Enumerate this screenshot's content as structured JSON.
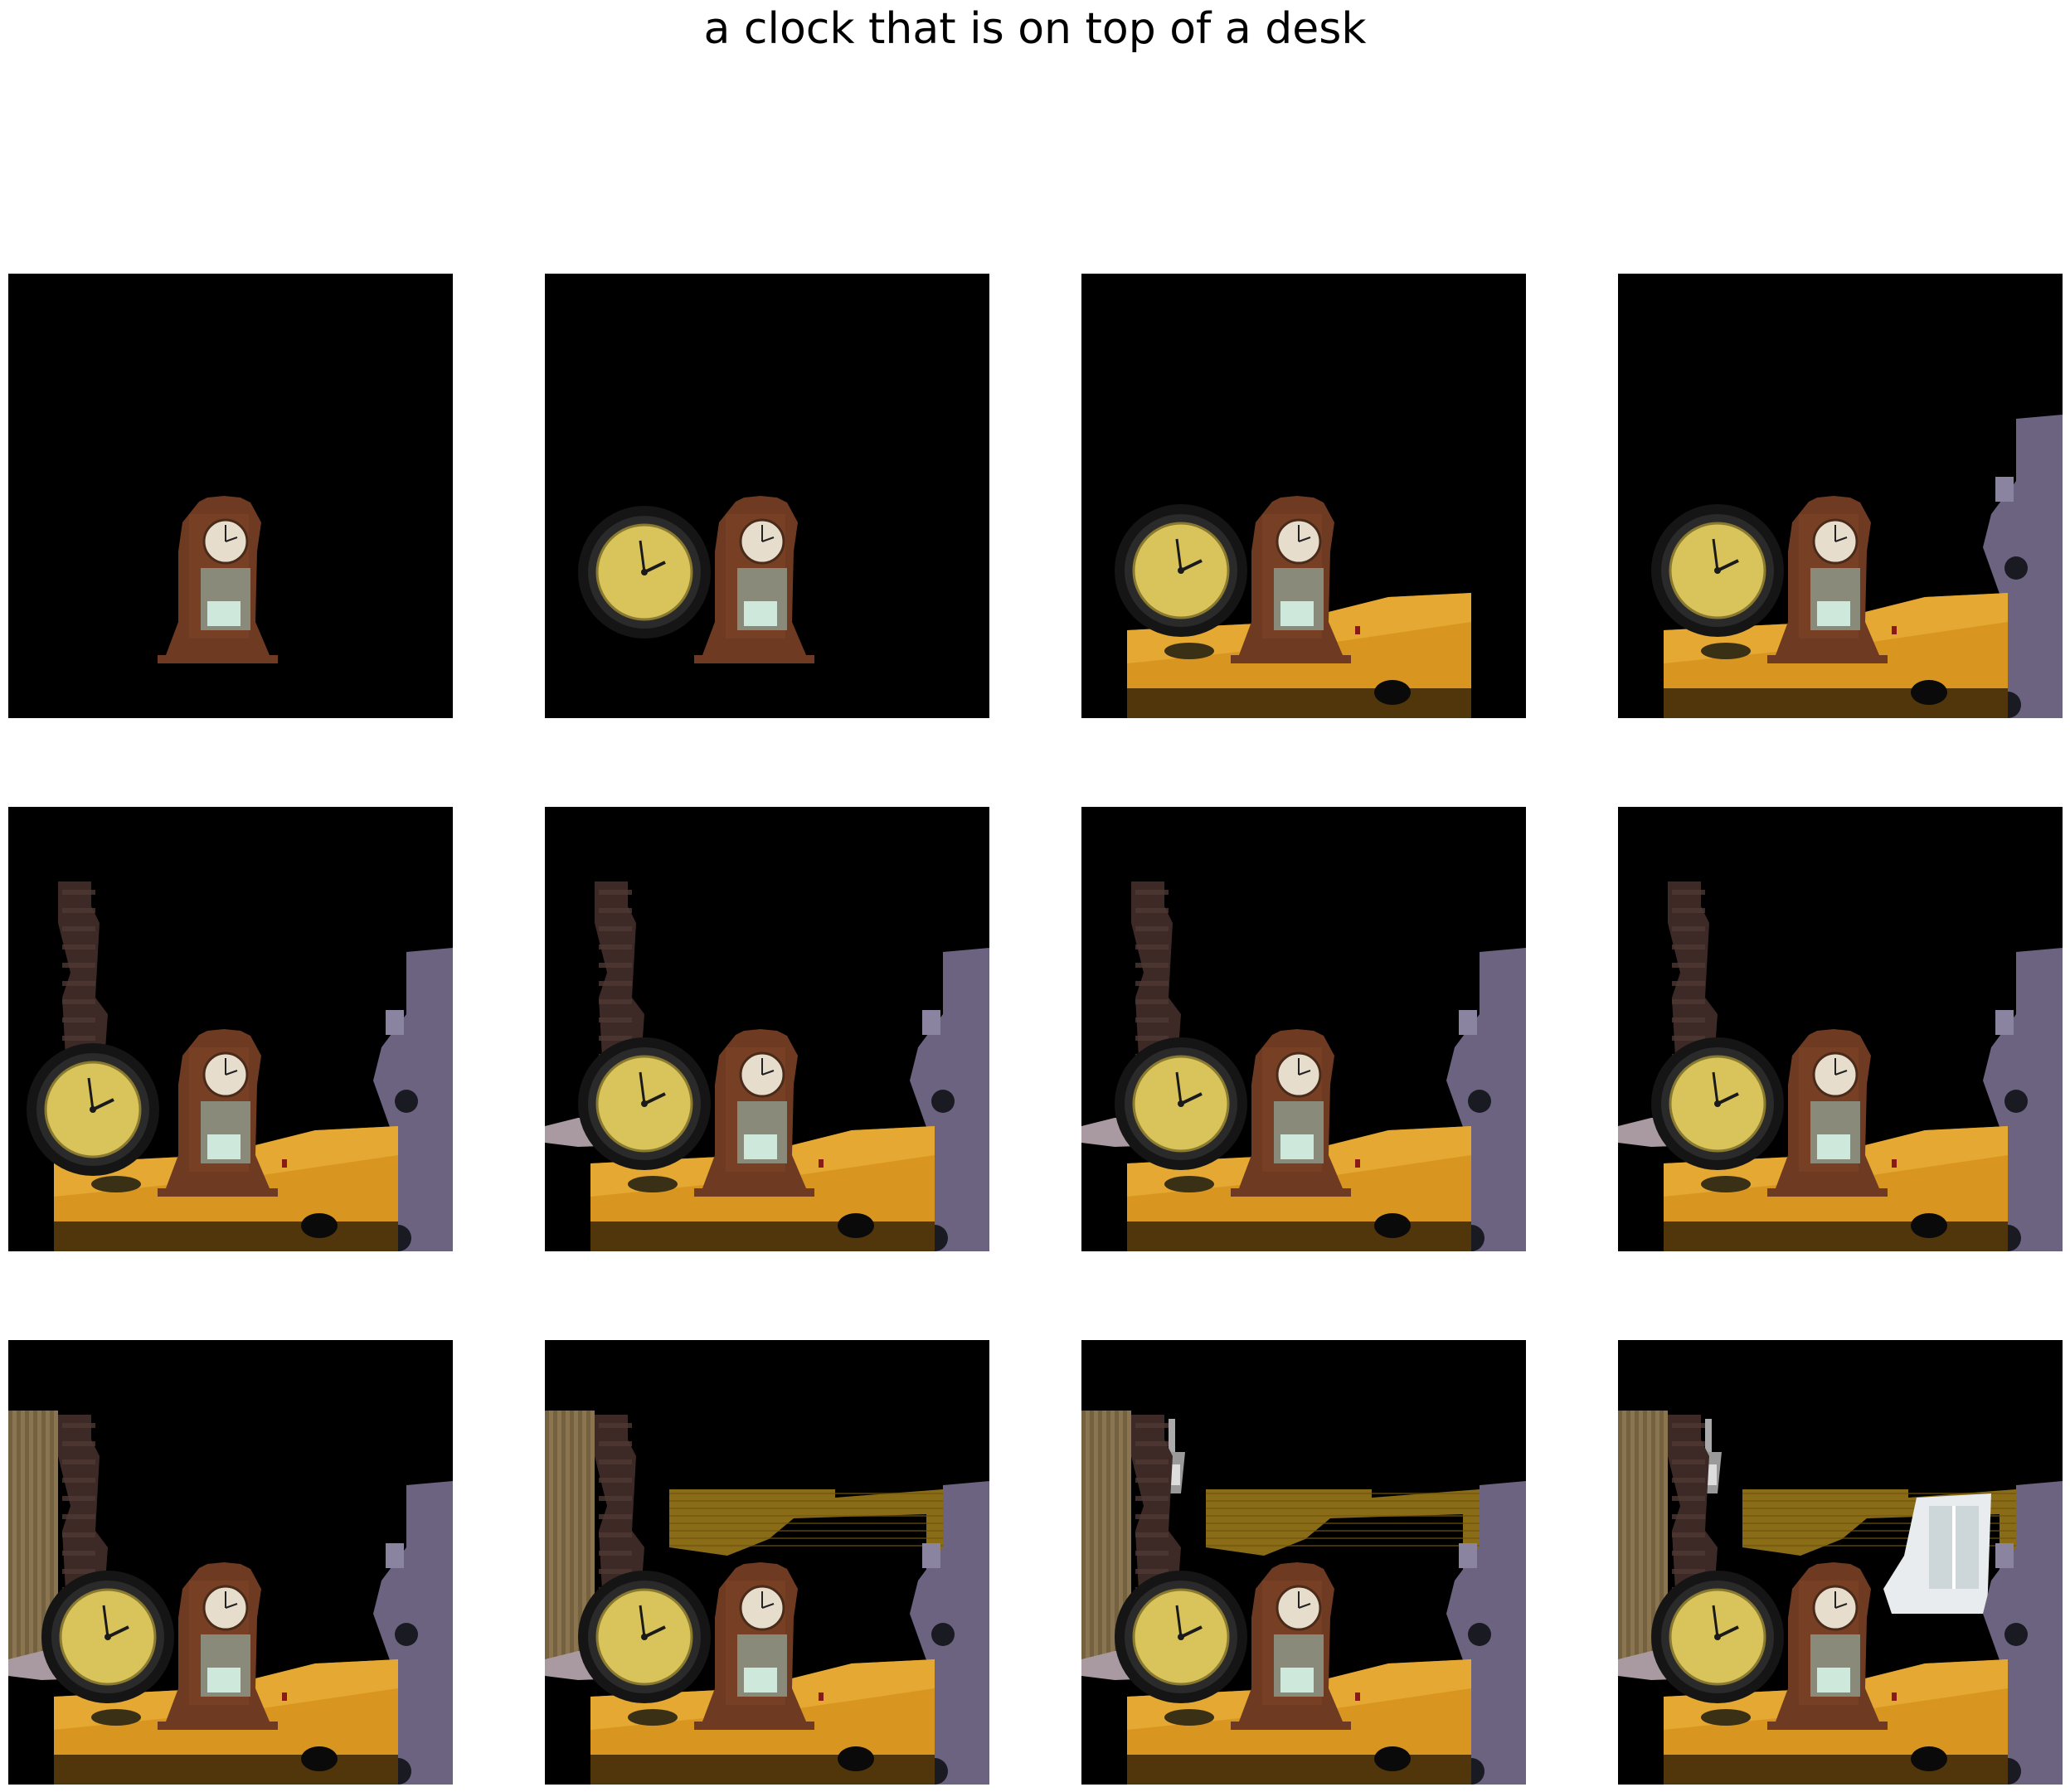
{
  "title": "a clock that is on top of a desk",
  "panels": [
    {
      "step": 1,
      "layers": [
        "mantel-clock"
      ]
    },
    {
      "step": 2,
      "layers": [
        "mantel-clock",
        "wall-clock"
      ]
    },
    {
      "step": 3,
      "layers": [
        "mantel-clock",
        "wall-clock",
        "desk"
      ]
    },
    {
      "step": 4,
      "layers": [
        "mantel-clock",
        "wall-clock",
        "desk",
        "right-object"
      ]
    },
    {
      "step": 5,
      "layers": [
        "mantel-clock",
        "wall-clock",
        "desk",
        "right-object",
        "left-pillar"
      ]
    },
    {
      "step": 6,
      "layers": [
        "mantel-clock",
        "wall-clock",
        "desk",
        "right-object",
        "left-pillar",
        "rug"
      ]
    },
    {
      "step": 7,
      "layers": [
        "mantel-clock",
        "wall-clock",
        "desk",
        "right-object",
        "left-pillar",
        "rug"
      ]
    },
    {
      "step": 8,
      "layers": [
        "mantel-clock",
        "wall-clock",
        "desk",
        "right-object",
        "left-pillar",
        "rug"
      ]
    },
    {
      "step": 9,
      "layers": [
        "mantel-clock",
        "wall-clock",
        "desk",
        "right-object",
        "left-pillar",
        "rug",
        "curtain"
      ]
    },
    {
      "step": 10,
      "layers": [
        "mantel-clock",
        "wall-clock",
        "desk",
        "right-object",
        "left-pillar",
        "rug",
        "curtain",
        "wood-panel"
      ]
    },
    {
      "step": 11,
      "layers": [
        "mantel-clock",
        "wall-clock",
        "desk",
        "right-object",
        "left-pillar",
        "rug",
        "curtain",
        "wood-panel",
        "lamp"
      ]
    },
    {
      "step": 12,
      "layers": [
        "mantel-clock",
        "wall-clock",
        "desk",
        "right-object",
        "left-pillar",
        "rug",
        "curtain",
        "wood-panel",
        "lamp",
        "window"
      ]
    }
  ]
}
